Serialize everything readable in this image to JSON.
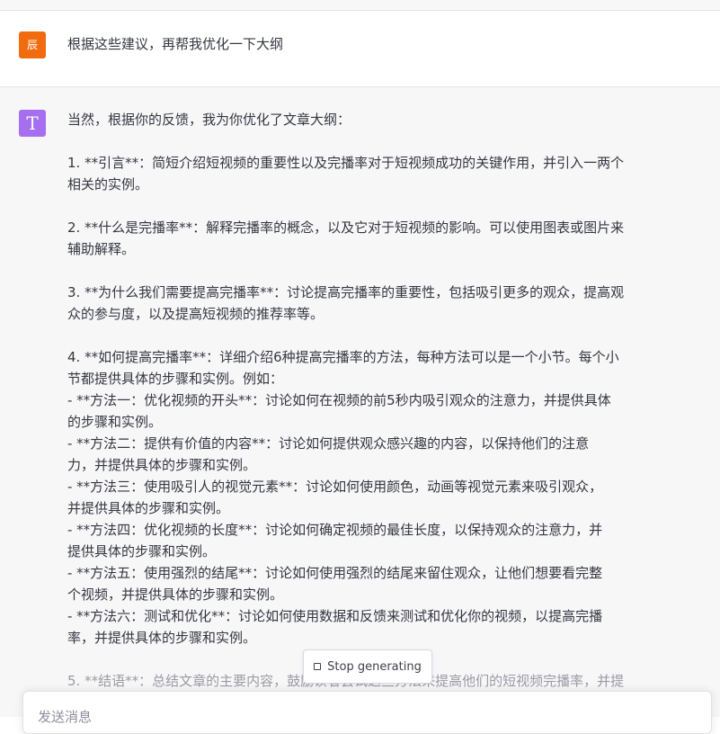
{
  "user_message": {
    "avatar_text": "辰",
    "avatar_color": "#f26c0f",
    "text": "根据这些建议，再帮我优化一下大纲"
  },
  "assistant_message": {
    "avatar_text": "T",
    "avatar_color": "#a56ff0",
    "lines": [
      "当然，根据你的反馈，我为你优化了文章大纲：",
      "",
      "1. **引言**：简短介绍短视频的重要性以及完播率对于短视频成功的关键作用，并引入一两个",
      "相关的实例。",
      "",
      "2. **什么是完播率**：解释完播率的概念，以及它对于短视频的影响。可以使用图表或图片来",
      "辅助解释。",
      "",
      "3. **为什么我们需要提高完播率**：讨论提高完播率的重要性，包括吸引更多的观众，提高观",
      "众的参与度，以及提高短视频的推荐率等。",
      "",
      "4. **如何提高完播率**：详细介绍6种提高完播率的方法，每种方法可以是一个小节。每个小",
      "节都提供具体的步骤和实例。例如：",
      "  - **方法一：优化视频的开头**：讨论如何在视频的前5秒内吸引观众的注意力，并提供具体",
      "的步骤和实例。",
      "  - **方法二：提供有价值的内容**：讨论如何提供观众感兴趣的内容，以保持他们的注意",
      "力，并提供具体的步骤和实例。",
      "  - **方法三：使用吸引人的视觉元素**：讨论如何使用颜色，动画等视觉元素来吸引观众，",
      "并提供具体的步骤和实例。",
      "  - **方法四：优化视频的长度**：讨论如何确定视频的最佳长度，以保持观众的注意力，并",
      "提供具体的步骤和实例。",
      "  - **方法五：使用强烈的结尾**：讨论如何使用强烈的结尾来留住观众，让他们想要看完整",
      "个视频，并提供具体的步骤和实例。",
      "  - **方法六：测试和优化**：讨论如何使用数据和反馈来测试和优化你的视频，以提高完播",
      "率，并提供具体的步骤和实例。",
      "",
      "5. **结语**：总结文章的主要内容，鼓励读者尝试这些方法来提高他们的短视频完播率，并提"
    ]
  },
  "stop_button": {
    "label": "Stop generating"
  },
  "composer": {
    "placeholder": "发送消息"
  }
}
